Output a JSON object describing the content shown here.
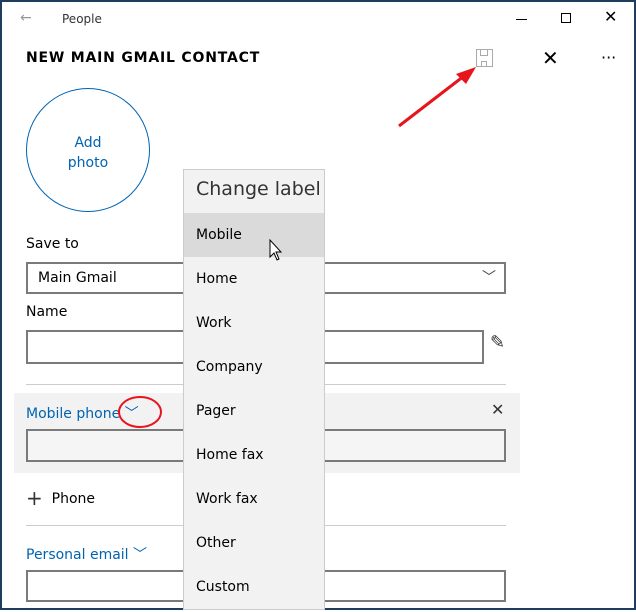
{
  "window": {
    "title": "People"
  },
  "header": {
    "title": "NEW MAIN GMAIL CONTACT"
  },
  "photo": {
    "label_line1": "Add",
    "label_line2": "photo"
  },
  "save_to": {
    "label": "Save to",
    "value": "Main Gmail"
  },
  "name": {
    "label": "Name",
    "value": ""
  },
  "phone": {
    "label": "Mobile phone",
    "value": "",
    "add_label": "Phone"
  },
  "email": {
    "label": "Personal email",
    "value": ""
  },
  "menu": {
    "title": "Change label",
    "items": [
      "Mobile",
      "Home",
      "Work",
      "Company",
      "Pager",
      "Home fax",
      "Work fax",
      "Other",
      "Custom"
    ],
    "selected": "Mobile"
  },
  "colors": {
    "accent": "#0063b1",
    "annotation": "#e8141b"
  }
}
